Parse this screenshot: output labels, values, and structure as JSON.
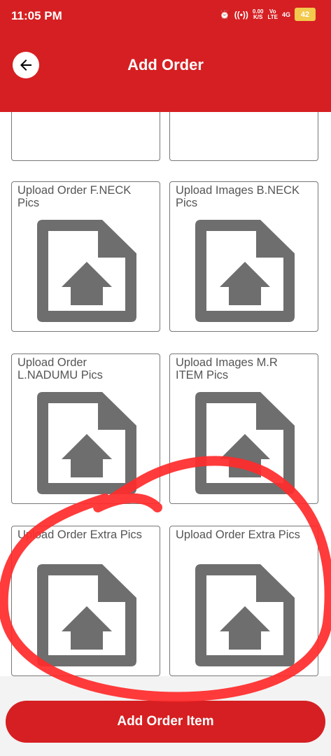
{
  "status_bar": {
    "time": "11:05 PM",
    "net_speed": "0.00\nK/S",
    "volte": "Vo\nLTE",
    "network": "4G",
    "battery": "42"
  },
  "header": {
    "title": "Add Order"
  },
  "cards": [
    {
      "label": ""
    },
    {
      "label": ""
    },
    {
      "label": "Upload Order F.NECK\nPics"
    },
    {
      "label": "Upload Images B.NECK\nPics"
    },
    {
      "label": "Upload Order\nL.NADUMU Pics"
    },
    {
      "label": "Upload Images M.R\nITEM Pics"
    },
    {
      "label": "Upload Order Extra Pics"
    },
    {
      "label": "Upload Order Extra Pics"
    }
  ],
  "action_button": {
    "label": "Add Order Item"
  },
  "colors": {
    "primary": "#d61f22",
    "icon_gray": "#6e6e6e",
    "annotation_red": "#ff2a2a"
  },
  "icons": [
    "back-arrow-icon",
    "upload-file-icon",
    "alarm-icon",
    "hotspot-icon",
    "signal-icon",
    "battery-icon"
  ]
}
